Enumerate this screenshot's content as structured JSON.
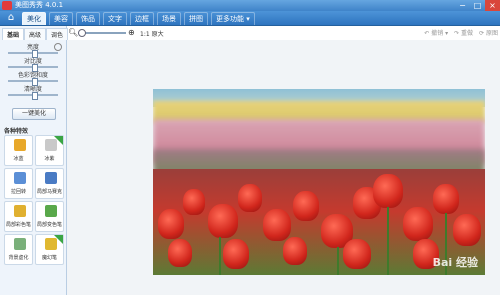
{
  "window": {
    "title": "美图秀秀 4.0.1",
    "controls": [
      "−",
      "□",
      "×"
    ]
  },
  "toolbar": {
    "home_icon": "home-icon",
    "tabs": [
      {
        "label": "美化",
        "active": true
      },
      {
        "label": "美容",
        "active": false
      },
      {
        "label": "饰品",
        "active": false
      },
      {
        "label": "文字",
        "active": false
      },
      {
        "label": "边框",
        "active": false
      },
      {
        "label": "场景",
        "active": false
      },
      {
        "label": "拼图",
        "active": false
      },
      {
        "label": "更多功能 ▾",
        "active": false
      }
    ]
  },
  "left_panel": {
    "subtabs": [
      "基础",
      "高级",
      "调色"
    ],
    "sliders": [
      {
        "label": "亮度",
        "level": 0.5
      },
      {
        "label": "对比度",
        "level": 0.5
      },
      {
        "label": "色彩饱和度",
        "level": 0.5
      },
      {
        "label": "清晰度",
        "level": 0.5
      }
    ],
    "onekey_label": "一键美化",
    "section_title": "各种特效",
    "effects": [
      {
        "label": "冰蓝",
        "icon": "pencil-icon",
        "color": "#e8a82a",
        "new": false
      },
      {
        "label": "冰紫",
        "icon": "eraser-icon",
        "color": "#c9c9c9",
        "new": true
      },
      {
        "label": "拉回转",
        "icon": "blur-icon",
        "color": "#5b8fd6",
        "new": false
      },
      {
        "label": "局部马赛克",
        "icon": "mosaic-icon",
        "color": "#4a7bc4",
        "new": false
      },
      {
        "label": "局部彩色笔",
        "icon": "brush-icon",
        "color": "#e0b030",
        "new": false
      },
      {
        "label": "局部变色笔",
        "icon": "color-brush-icon",
        "color": "#59a84a",
        "new": false
      },
      {
        "label": "背景虚化",
        "icon": "bokeh-icon",
        "color": "#7ab07a",
        "new": false
      },
      {
        "label": "魔幻笔",
        "icon": "magic-pen-icon",
        "color": "#e0b830",
        "new": true
      }
    ]
  },
  "zoom": {
    "label": "1:1 原大"
  },
  "right_tools": [
    "↶ 撤销 ▾",
    "↷ 重做",
    "⟳ 原图"
  ],
  "image": {
    "watermark": "Bai 经验"
  }
}
